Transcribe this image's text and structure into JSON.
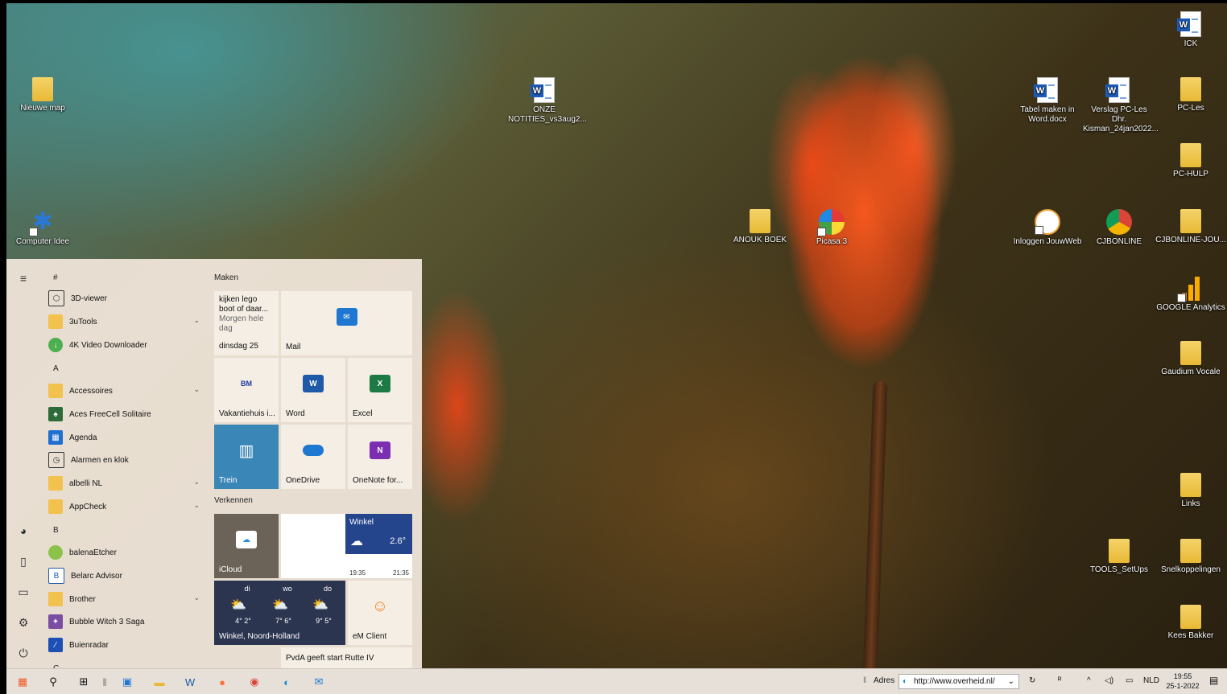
{
  "desktop": {
    "icons": [
      {
        "label": "Nieuwe map",
        "icon": "folder-icon"
      },
      {
        "label": "Computer Idee",
        "icon": "snowflake-shortcut-icon"
      },
      {
        "label": "ONZE NOTITIES_vs3aug2...",
        "icon": "word-document-icon"
      },
      {
        "label": "ANOUK BOEK",
        "icon": "folder-icon"
      },
      {
        "label": "Picasa 3",
        "icon": "picasa-icon"
      },
      {
        "label": "Tabel maken in Word.docx",
        "icon": "word-document-icon"
      },
      {
        "label": "Verslag PC-Les Dhr. Kisman_24jan2022...",
        "icon": "word-document-icon"
      },
      {
        "label": "Inloggen JouwWeb",
        "icon": "chrome-shortcut-icon"
      },
      {
        "label": "CJBONLINE",
        "icon": "chrome-icon"
      },
      {
        "label": "ICK",
        "icon": "word-document-icon"
      },
      {
        "label": "PC-Les",
        "icon": "folder-icon"
      },
      {
        "label": "PC-HULP",
        "icon": "folder-icon"
      },
      {
        "label": "CJBONLINE-JOU...",
        "icon": "folder-icon"
      },
      {
        "label": "GOOGLE Analytics",
        "icon": "analytics-icon"
      },
      {
        "label": "Gaudium Vocale",
        "icon": "folder-icon"
      },
      {
        "label": "Links",
        "icon": "folder-icon"
      },
      {
        "label": "TOOLS_SetUps",
        "icon": "folder-icon"
      },
      {
        "label": "Snelkoppelingen",
        "icon": "folder-icon"
      },
      {
        "label": "Kees Bakker",
        "icon": "user-folder-icon"
      }
    ]
  },
  "start_menu": {
    "apps": [
      {
        "kind": "header",
        "label": "#"
      },
      {
        "kind": "app",
        "label": "3D-viewer",
        "icon": "cube-icon"
      },
      {
        "kind": "folder",
        "label": "3uTools",
        "icon": "folder-icon"
      },
      {
        "kind": "app",
        "label": "4K Video Downloader",
        "icon": "download-icon"
      },
      {
        "kind": "header",
        "label": "A"
      },
      {
        "kind": "folder",
        "label": "Accessoires",
        "icon": "folder-icon"
      },
      {
        "kind": "app",
        "label": "Aces FreeCell Solitaire",
        "icon": "cards-icon"
      },
      {
        "kind": "app",
        "label": "Agenda",
        "icon": "calendar-icon"
      },
      {
        "kind": "app",
        "label": "Alarmen en klok",
        "icon": "clock-icon"
      },
      {
        "kind": "folder",
        "label": "albelli NL",
        "icon": "folder-icon"
      },
      {
        "kind": "folder",
        "label": "AppCheck",
        "icon": "folder-icon"
      },
      {
        "kind": "header",
        "label": "B"
      },
      {
        "kind": "app",
        "label": "balenaEtcher",
        "icon": "etcher-icon"
      },
      {
        "kind": "app",
        "label": "Belarc Advisor",
        "icon": "belarc-icon"
      },
      {
        "kind": "folder",
        "label": "Brother",
        "icon": "folder-icon"
      },
      {
        "kind": "app",
        "label": "Bubble Witch 3 Saga",
        "icon": "game-icon"
      },
      {
        "kind": "app",
        "label": "Buienradar",
        "icon": "radar-icon"
      },
      {
        "kind": "header",
        "label": "C"
      }
    ],
    "groups": {
      "maken": "Maken",
      "verkennen": "Verkennen"
    },
    "tiles": {
      "calendar": {
        "event": "kijken lego boot of daar...",
        "when": "Morgen hele dag",
        "date": "dinsdag 25"
      },
      "mail": "Mail",
      "vakantiehuis": "Vakantiehuis i...",
      "word": "Word",
      "excel": "Excel",
      "trein": "Trein",
      "onedrive": "OneDrive",
      "onenote": "OneNote for...",
      "icloud": "iCloud",
      "weather_small": {
        "place": "Winkel",
        "temp": "2.6°",
        "t1": "19:35",
        "t2": "21:35"
      },
      "forecast": {
        "days": [
          {
            "day": "di",
            "temp": "4° 2°"
          },
          {
            "day": "wo",
            "temp": "7° 6°"
          },
          {
            "day": "do",
            "temp": "9° 5°"
          }
        ],
        "place": "Winkel, Noord-Holland"
      },
      "emclient": "eM Client",
      "news": "PvdA geeft start Rutte IV"
    }
  },
  "taskbar": {
    "address_label": "Adres",
    "address_value": "http://www.overheid.nl/",
    "language": "NLD",
    "time": "19:55",
    "date": "25-1-2022"
  },
  "colors": {
    "accent_blue": "#1e5aa8",
    "trein_tile": "#3a86b6",
    "icloud_tile": "#6b6258",
    "weather_tile": "#24448c",
    "forecast_tile": "#2b3550"
  }
}
